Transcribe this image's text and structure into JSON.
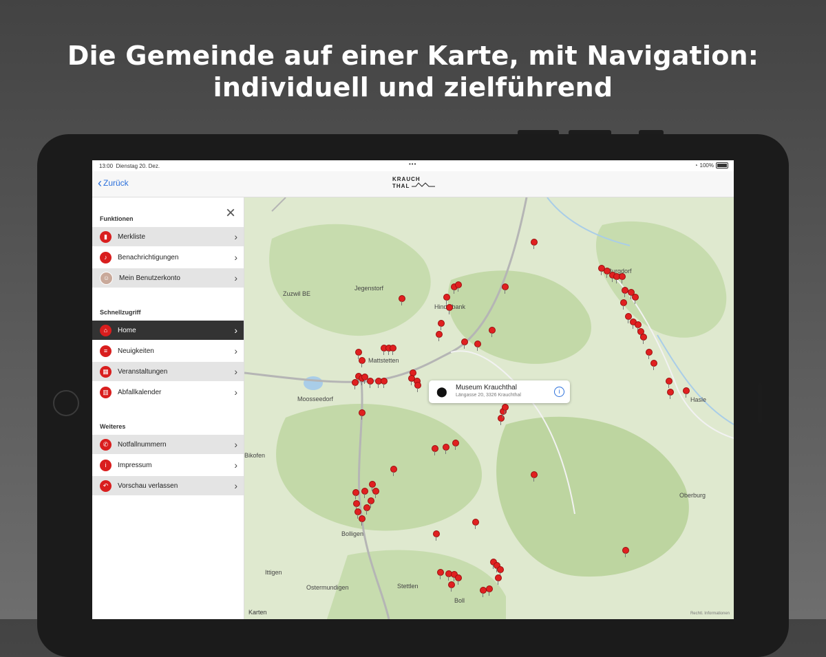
{
  "headline": {
    "line1": "Die Gemeinde auf einer Karte, mit Navigation:",
    "line2": "individuell und zielführend"
  },
  "statusbar": {
    "time": "13:00",
    "date": "Dienstag 20. Dez.",
    "battery": "100%"
  },
  "navbar": {
    "back_label": "Zurück",
    "logo_line1": "KRAUCH",
    "logo_line2": "THAL"
  },
  "sidebar": {
    "sections": [
      {
        "title": "Funktionen",
        "items": [
          {
            "label": "Merkliste",
            "icon": "bookmark-icon"
          },
          {
            "label": "Benachrichtigungen",
            "icon": "bell-icon"
          },
          {
            "label": "Mein Benutzerkonto",
            "icon": "avatar-icon"
          }
        ]
      },
      {
        "title": "Schnellzugriff",
        "items": [
          {
            "label": "Home",
            "icon": "home-icon",
            "active": true
          },
          {
            "label": "Neuigkeiten",
            "icon": "news-icon"
          },
          {
            "label": "Veranstaltungen",
            "icon": "calendar-icon"
          },
          {
            "label": "Abfallkalender",
            "icon": "trash-icon"
          }
        ]
      },
      {
        "title": "Weiteres",
        "items": [
          {
            "label": "Notfallnummern",
            "icon": "phone-icon"
          },
          {
            "label": "Impressum",
            "icon": "info-icon"
          },
          {
            "label": "Vorschau verlassen",
            "icon": "exit-icon"
          }
        ]
      }
    ]
  },
  "map": {
    "places": [
      "Jegenstorf",
      "Zuzwil BE",
      "Hindelbank",
      "Burgdorf",
      "Mattstetten",
      "Moosseedorf",
      "Hasle",
      "Bolligen",
      "Ittigen",
      "Ostermundigen",
      "Stettlen",
      "Boll",
      "Oberburg",
      "Bikofen"
    ],
    "callout": {
      "title": "Museum Krauchthal",
      "address": "Längasse 20, 3326 Krauchthal"
    },
    "brand": "Karten",
    "legal": "Rechtl. Informationen"
  },
  "colors": {
    "accent": "#d91e1e",
    "link": "#2a6fdb",
    "map_green": "#c7dcae"
  }
}
